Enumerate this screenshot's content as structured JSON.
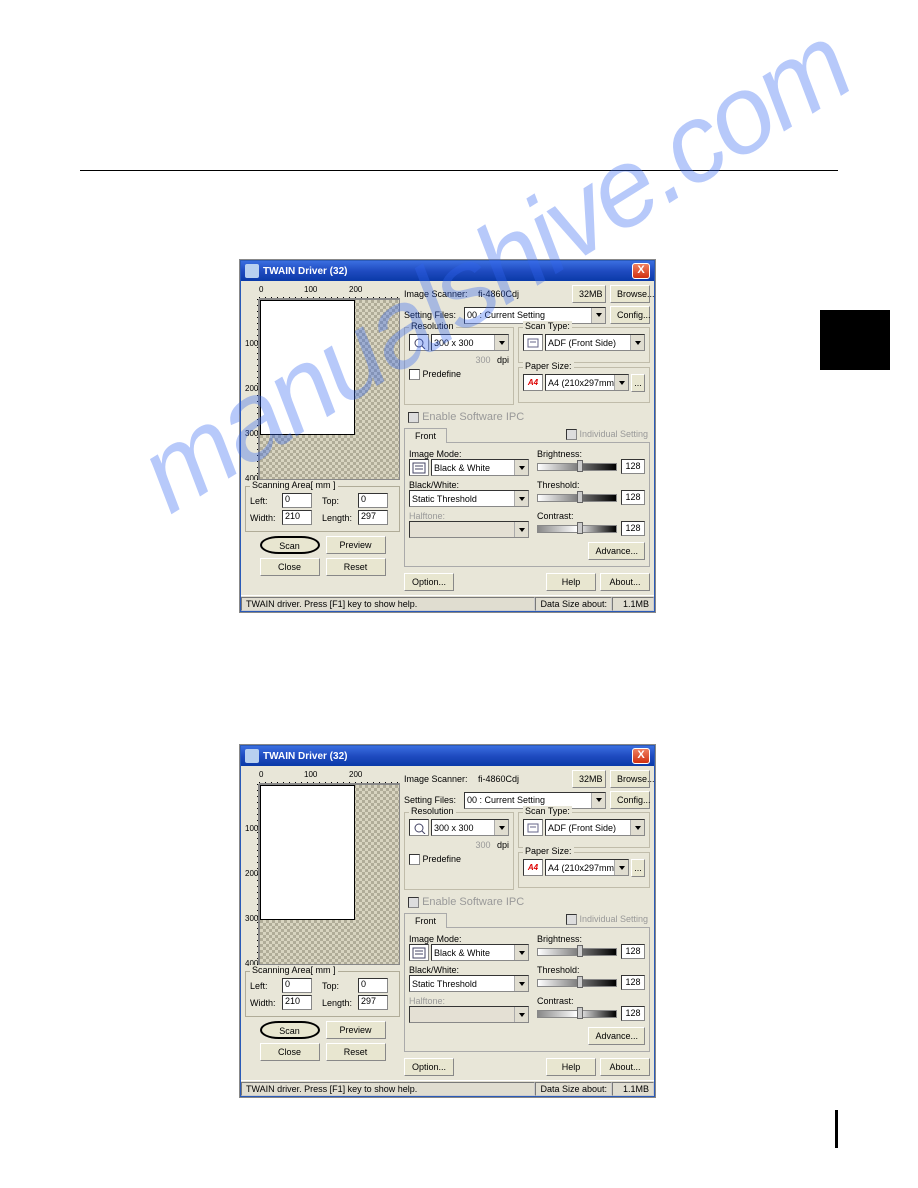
{
  "ruler": {
    "h0": "0",
    "h100": "100",
    "h200": "200",
    "v100": "100",
    "v200": "200",
    "v300": "300",
    "v400": "400"
  },
  "dialog": {
    "title": "TWAIN Driver (32)",
    "close": "X",
    "imageScannerLabel": "Image Scanner:",
    "imageScannerValue": "fi-4860Cdj",
    "memBtn": "32MB",
    "browseBtn": "Browse...",
    "settingFilesLabel": "Setting Files:",
    "settingFilesValue": "00 : Current Setting",
    "configBtn": "Config...",
    "resolution": {
      "legend": "Resolution",
      "value": "300 x 300",
      "dpiLabel": "dpi",
      "dpiValue": "300",
      "predefineLabel": "Predefine"
    },
    "scanType": {
      "legend": "Scan Type:",
      "value": "ADF (Front Side)"
    },
    "paperSize": {
      "legend": "Paper Size:",
      "value": "A4 (210x297mm)",
      "icon": "A4"
    },
    "enableIPC": "Enable Software IPC",
    "frontTab": "Front",
    "individualSetting": "Individual Setting",
    "imageMode": {
      "label": "Image Mode:",
      "value": "Black & White"
    },
    "blackWhite": {
      "label": "Black/White:",
      "value": "Static Threshold"
    },
    "halftone": {
      "label": "Halftone:"
    },
    "brightness": {
      "label": "Brightness:",
      "value": "128"
    },
    "threshold": {
      "label": "Threshold:",
      "value": "128"
    },
    "contrast": {
      "label": "Contrast:",
      "value": "128"
    },
    "advanceBtn": "Advance...",
    "optionBtn": "Option...",
    "helpBtn": "Help",
    "aboutBtn": "About...",
    "scanArea": {
      "legend": "Scanning Area[ mm ]",
      "leftLabel": "Left:",
      "leftValue": "0",
      "topLabel": "Top:",
      "topValue": "0",
      "widthLabel": "Width:",
      "widthValue": "210",
      "lengthLabel": "Length:",
      "lengthValue": "297"
    },
    "scanBtn": "Scan",
    "previewBtn": "Preview",
    "closeBtn": "Close",
    "resetBtn": "Reset",
    "status": {
      "help": "TWAIN driver. Press [F1] key to show help.",
      "dataSizeLabel": "Data Size about:",
      "dataSizeValue": "1.1MB"
    }
  },
  "watermark": "manualshive.com"
}
